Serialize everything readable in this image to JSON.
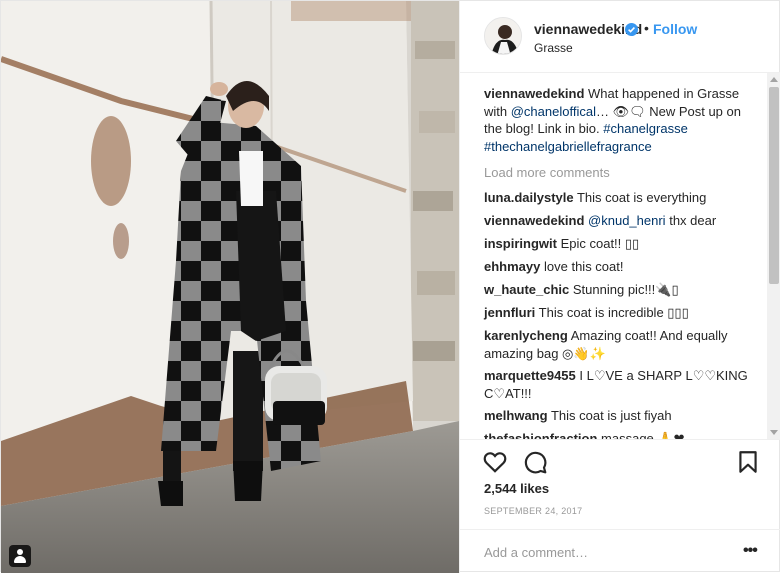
{
  "header": {
    "username": "viennawedekind",
    "dot": "•",
    "follow_label": "Follow",
    "location": "Grasse"
  },
  "caption": {
    "username": "viennawedekind",
    "text_1": " What happened in Grasse with ",
    "mention": "@chaneloffical",
    "text_2": "… 👁🗨 New Post up on the blog! Link in bio. ",
    "hashtag_1": "#chanelgrasse",
    "hashtag_2": "#thechanelgabriellefragrance"
  },
  "load_more_label": "Load more comments",
  "comments": [
    {
      "user": "luna.dailystyle",
      "text": "This coat is everything"
    },
    {
      "user": "viennawedekind",
      "mention": "@knud_henri",
      "text": "thx dear"
    },
    {
      "user": "inspiringwit",
      "text": "Epic coat!! ▯▯"
    },
    {
      "user": "ehhmayy",
      "text": "love this coat!"
    },
    {
      "user": "w_haute_chic",
      "text": "Stunning pic!!!🔌▯"
    },
    {
      "user": "jennfluri",
      "text": "This coat is incredible ▯▯▯"
    },
    {
      "user": "karenlycheng",
      "text": "Amazing coat!! And equally amazing bag ◎👋✨"
    },
    {
      "user": "marquette9455",
      "text": "I L♡VE a SHARP L♡♡KING C♡AT!!!"
    },
    {
      "user": "melhwang",
      "text": "This coat is just fiyah"
    },
    {
      "user": "thefashionfraction",
      "text": "massage 🙏❤"
    }
  ],
  "likes": "2,544 likes",
  "date": "SEPTEMBER 24, 2017",
  "add_comment_placeholder": "Add a comment…",
  "more_label": "•••",
  "icons": {
    "like": "heart-icon",
    "comment": "comment-icon",
    "save": "bookmark-icon",
    "verified": "verified-badge-icon",
    "user_tags": "user-tag-icon"
  },
  "colors": {
    "link": "#003569",
    "follow": "#3897f0",
    "muted": "#999999",
    "verified": "#3897f0"
  }
}
